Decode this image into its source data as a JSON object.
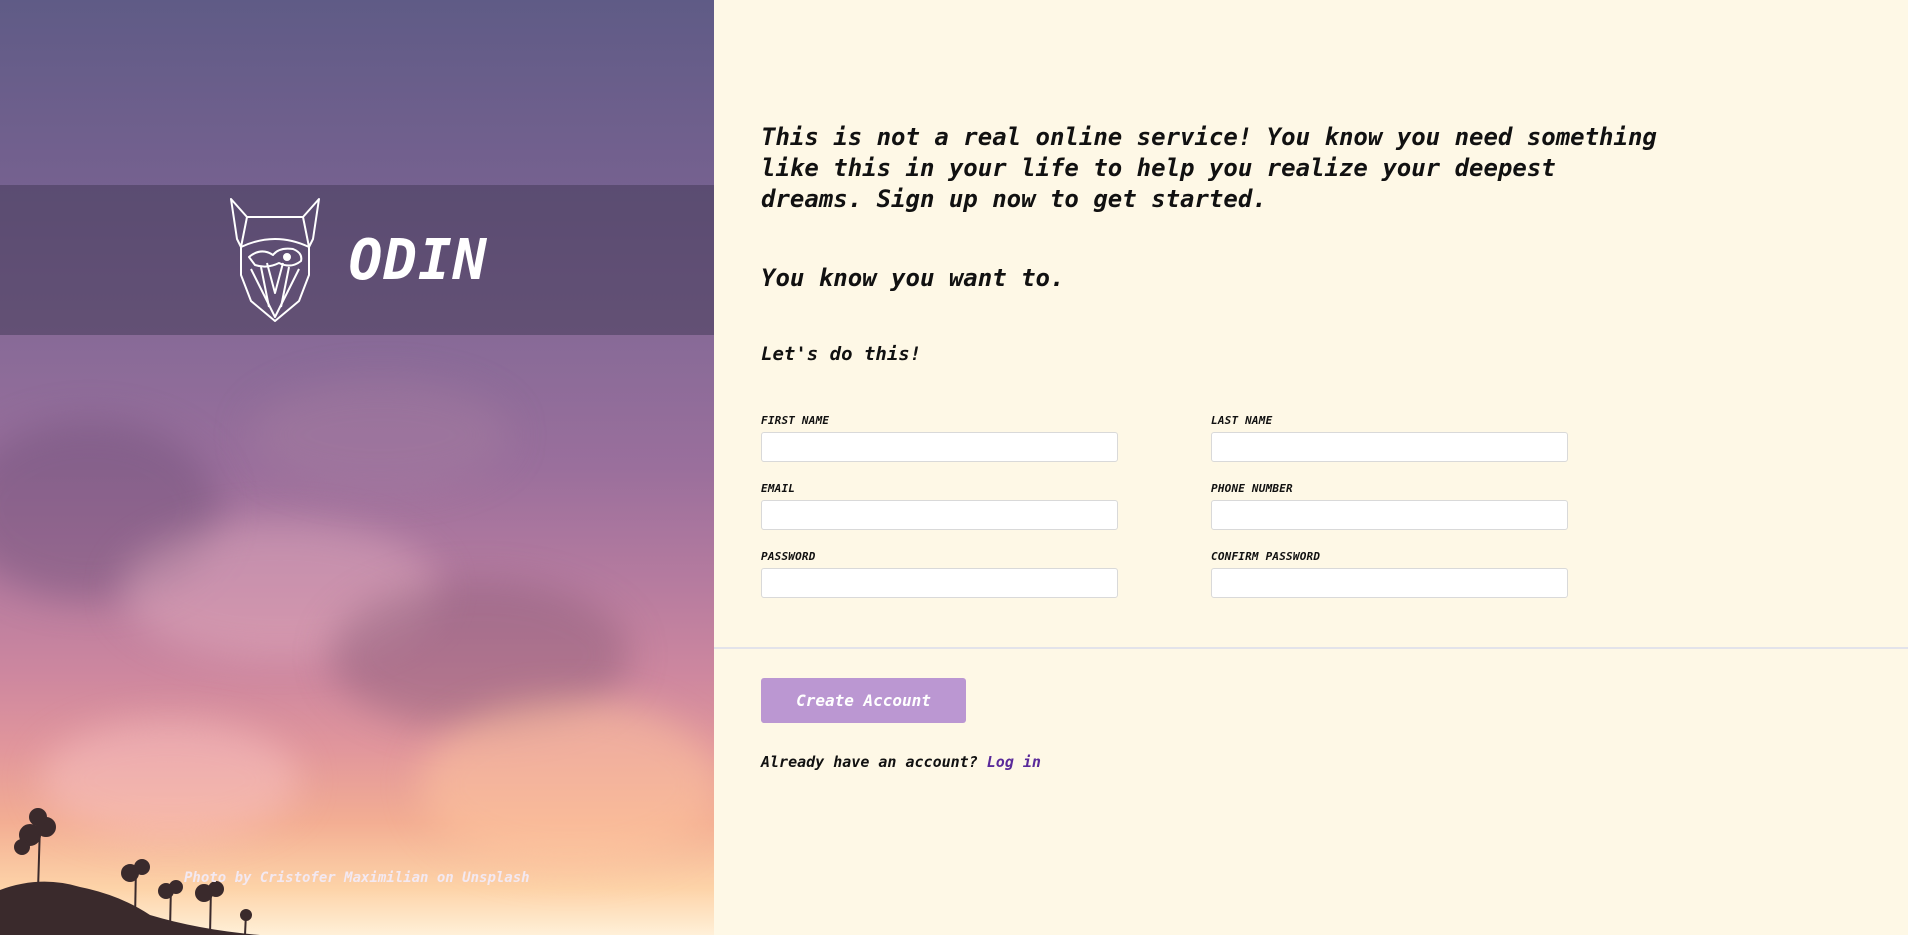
{
  "brand": {
    "name": "ODIN",
    "logo_icon": "viking-helmet-logo-icon"
  },
  "photo_credit": {
    "prefix": "Photo by ",
    "author": "Cristofer Maximilian",
    "middle": " on ",
    "site": "Unsplash"
  },
  "content": {
    "intro": "This is not a real online service! You know you need something like this in your life to help you realize your deepest dreams. Sign up now to get started.",
    "tagline": "You know you want to.",
    "cta": "Let's do this!"
  },
  "form": {
    "first_name": {
      "label": "FIRST NAME",
      "value": "",
      "placeholder": ""
    },
    "last_name": {
      "label": "LAST NAME",
      "value": "",
      "placeholder": ""
    },
    "email": {
      "label": "EMAIL",
      "value": "",
      "placeholder": ""
    },
    "phone": {
      "label": "PHONE NUMBER",
      "value": "",
      "placeholder": ""
    },
    "password": {
      "label": "PASSWORD",
      "value": "",
      "placeholder": ""
    },
    "confirm_password": {
      "label": "CONFIRM PASSWORD",
      "value": "",
      "placeholder": ""
    }
  },
  "actions": {
    "create_account_label": "Create Account",
    "login_prompt": "Already have an account?",
    "login_link": "Log in"
  },
  "colors": {
    "background_right": "#fef8e6",
    "button": "#bb97d2",
    "link": "#5a2a9a",
    "brand_band": "rgba(70,60,90,0.55)"
  }
}
